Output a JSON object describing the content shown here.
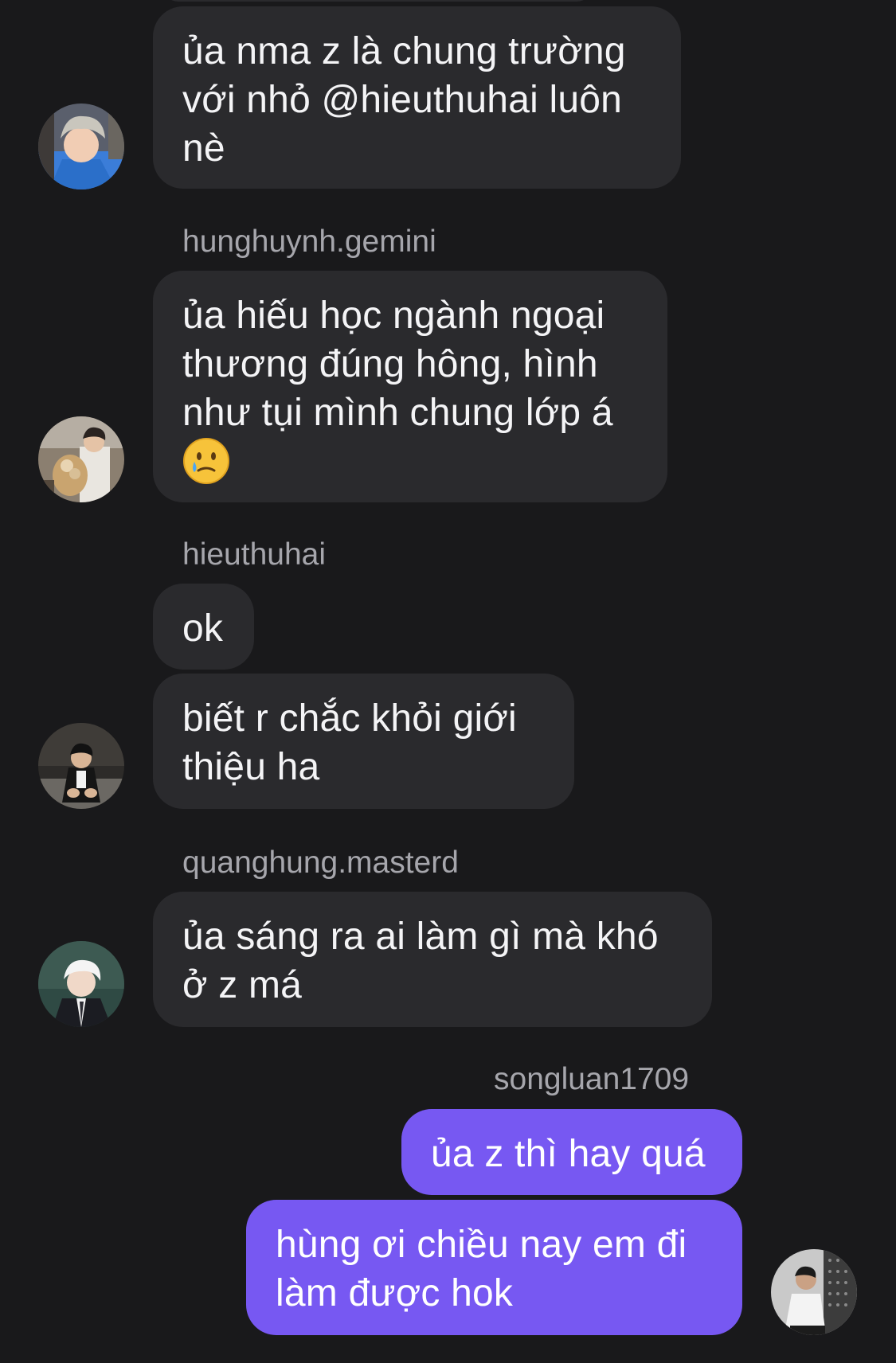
{
  "colors": {
    "background": "#19191b",
    "incoming_bubble": "#2a2a2d",
    "outgoing_bubble": "#7758f2",
    "sender_text": "#a6a6ac"
  },
  "messages": [
    {
      "sender": "",
      "lines": [
        "ủa nma z là chung trường",
        "với nhỏ @hieuthuhai luôn",
        "nè"
      ]
    },
    {
      "sender": "hunghuynh.gemini",
      "lines": [
        "ủa hiếu học ngành ngoại",
        "thương đúng hông, hình",
        "như tụi mình chung lớp á"
      ],
      "emoji": "face-holding-back-tears-icon"
    },
    {
      "sender": "hieuthuhai",
      "lines": [
        "ok"
      ]
    },
    {
      "sender": "",
      "lines": [
        "biết r chắc khỏi giới",
        "thiệu ha"
      ]
    },
    {
      "sender": "quanghung.masterd",
      "lines": [
        "ủa sáng ra ai làm gì mà khó",
        "ở z má"
      ]
    },
    {
      "sender": "songluan1709",
      "lines": [
        "ủa z thì hay quá"
      ]
    },
    {
      "sender": "",
      "lines": [
        "hùng ơi chiều nay em đi",
        "làm được hok"
      ]
    }
  ]
}
